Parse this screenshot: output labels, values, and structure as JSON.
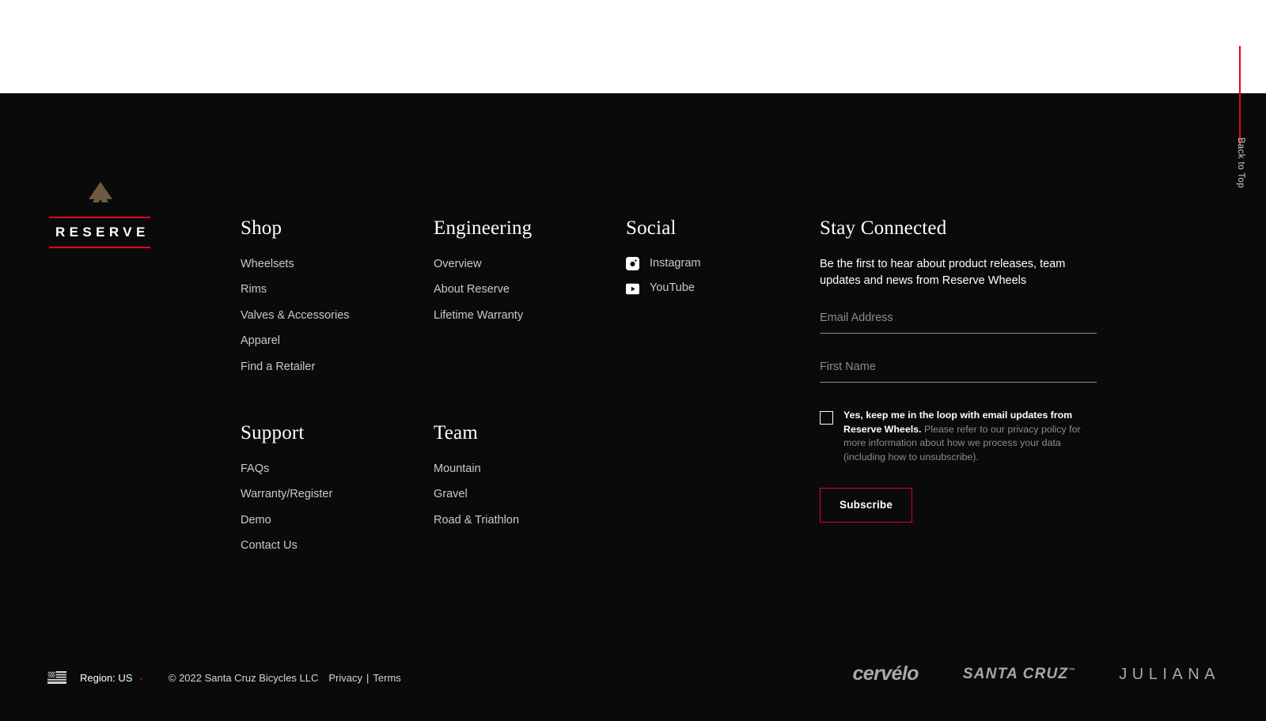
{
  "back_to_top": {
    "label": "Back to Top",
    "accent_color": "#e4002b"
  },
  "brand": {
    "wordmark": "RESERVE",
    "mark_icon": "reserve-chevron-logo",
    "mark_color": "#6d5a3f",
    "rule_color": "#e4002b"
  },
  "columns": [
    {
      "id": "shop",
      "heading": "Shop",
      "links": [
        "Wheelsets",
        "Rims",
        "Valves & Accessories",
        "Apparel",
        "Find a Retailer"
      ]
    },
    {
      "id": "engineering",
      "heading": "Engineering",
      "links": [
        "Overview",
        "About Reserve",
        "Lifetime Warranty"
      ]
    },
    {
      "id": "support",
      "heading": "Support",
      "links": [
        "FAQs",
        "Warranty/Register",
        "Demo",
        "Contact Us"
      ]
    },
    {
      "id": "team",
      "heading": "Team",
      "links": [
        "Mountain",
        "Gravel",
        "Road & Triathlon"
      ]
    }
  ],
  "social": {
    "heading": "Social",
    "items": [
      {
        "label": "Instagram",
        "icon": "instagram-icon"
      },
      {
        "label": "YouTube",
        "icon": "youtube-icon"
      }
    ]
  },
  "newsletter": {
    "heading": "Stay Connected",
    "blurb": "Be the first to hear about product releases, team updates and news from Reserve Wheels",
    "email": {
      "placeholder": "Email Address",
      "value": ""
    },
    "first_name": {
      "placeholder": "First Name",
      "value": ""
    },
    "consent": {
      "checked": false,
      "bold_text": "Yes, keep me in the loop with email updates from Reserve Wheels.",
      "rest_text": " Please refer to our privacy policy for more information about how we process your data (including how to unsubscribe)."
    },
    "submit_label": "Subscribe",
    "submit_border_color": "#e4002b"
  },
  "bottom_bar": {
    "flag_icon": "us-flag-icon",
    "region_label": "Region: US",
    "region_caret": "⌄",
    "copyright": "© 2022 Santa Cruz Bicycles LLC",
    "privacy_label": "Privacy",
    "separator": "|",
    "terms_label": "Terms",
    "partner_logos": [
      {
        "id": "cervelo",
        "text": "cervélo"
      },
      {
        "id": "santa-cruz",
        "text": "SANTA CRUZ",
        "tm": "™"
      },
      {
        "id": "juliana",
        "text": "JULIANA"
      }
    ]
  }
}
